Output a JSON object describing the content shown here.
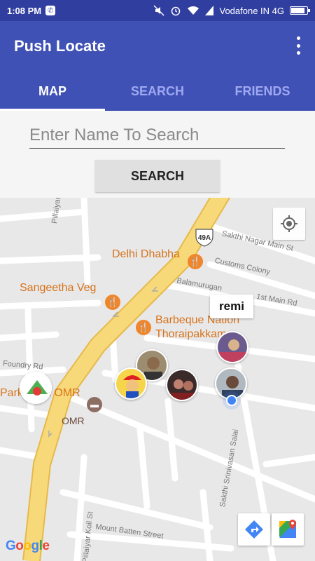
{
  "status_bar": {
    "time": "1:08 PM",
    "notification_icon": "whatsapp-icon",
    "carrier": "Vodafone IN 4G",
    "icons": [
      "mute-icon",
      "alarm-icon",
      "wifi-icon",
      "signal-icon",
      "battery-icon"
    ],
    "battery_level": 0.9
  },
  "app_bar": {
    "title": "Push Locate",
    "menu_icon": "overflow-menu-icon"
  },
  "tabs": [
    {
      "label": "MAP",
      "active": true
    },
    {
      "label": "SEARCH",
      "active": false
    },
    {
      "label": "FRIENDS",
      "active": false
    }
  ],
  "search": {
    "placeholder": "Enter Name To Search",
    "value": "",
    "button_label": "SEARCH"
  },
  "map": {
    "highway_shield": "49A",
    "places": [
      {
        "name": "Delhi Dhabha",
        "type": "restaurant"
      },
      {
        "name": "Sangeetha Veg",
        "type": "restaurant"
      },
      {
        "name": "Barbeque Nation",
        "name_line2": "Thoraipakkam",
        "type": "restaurant"
      },
      {
        "name": "Park",
        "name_suffix": "a OMR",
        "type": "place"
      },
      {
        "name": "OMR",
        "type": "hotel"
      }
    ],
    "streets": {
      "s1": "Pillaiyar Koil St",
      "s2": "Sakthi Nagar Main St",
      "s3": "Customs Colony",
      "s4": "Balamurugan",
      "s5": "1st Main Rd",
      "s6": "Foundry Rd",
      "s7": "Sakthi Srinivasan Salai",
      "s8": "Mount Batten Street",
      "s9": "Pillaiyar Koil St"
    },
    "callout_label": "remi",
    "friend_markers": [
      "friend-avatar-1",
      "friend-avatar-2",
      "friend-avatar-3",
      "friend-avatar-4",
      "friend-avatar-5",
      "friend-avatar-6"
    ],
    "attribution": "Google",
    "colors": {
      "road_major": "#f7d97a",
      "road_major_border": "#e6b94a",
      "poi": "#f0862b",
      "my_location": "#4285f4"
    }
  }
}
